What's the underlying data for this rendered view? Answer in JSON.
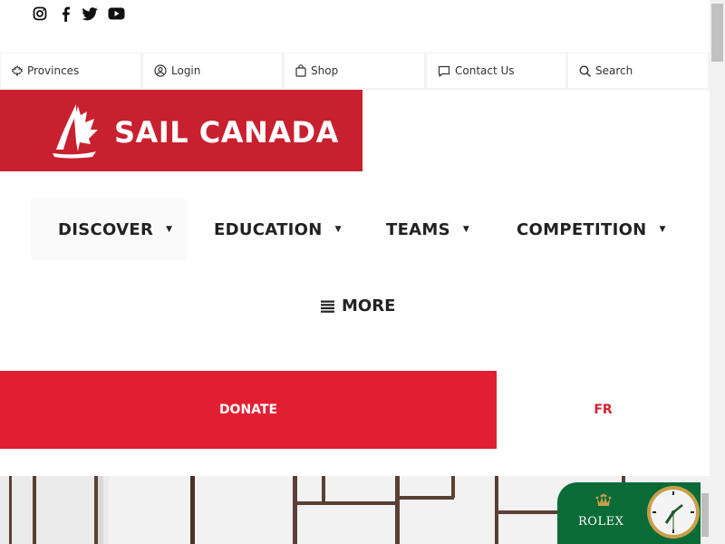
{
  "social": {
    "icons": [
      "instagram-icon",
      "facebook-icon",
      "twitter-icon",
      "youtube-icon"
    ]
  },
  "utility": {
    "provinces": "Provinces",
    "login": "Login",
    "shop": "Shop",
    "contact": "Contact Us",
    "search": "Search"
  },
  "logo": {
    "text": "SAIL CANADA"
  },
  "nav": {
    "items": [
      "DISCOVER",
      "EDUCATION",
      "TEAMS",
      "COMPETITION"
    ],
    "more": "MORE"
  },
  "actions": {
    "donate": "DONATE",
    "language": "FR"
  },
  "rolex": {
    "brand": "ROLEX"
  },
  "colors": {
    "brand_red": "#c9202f",
    "donate_red": "#e21f32",
    "rolex_green": "#0b6b37"
  }
}
